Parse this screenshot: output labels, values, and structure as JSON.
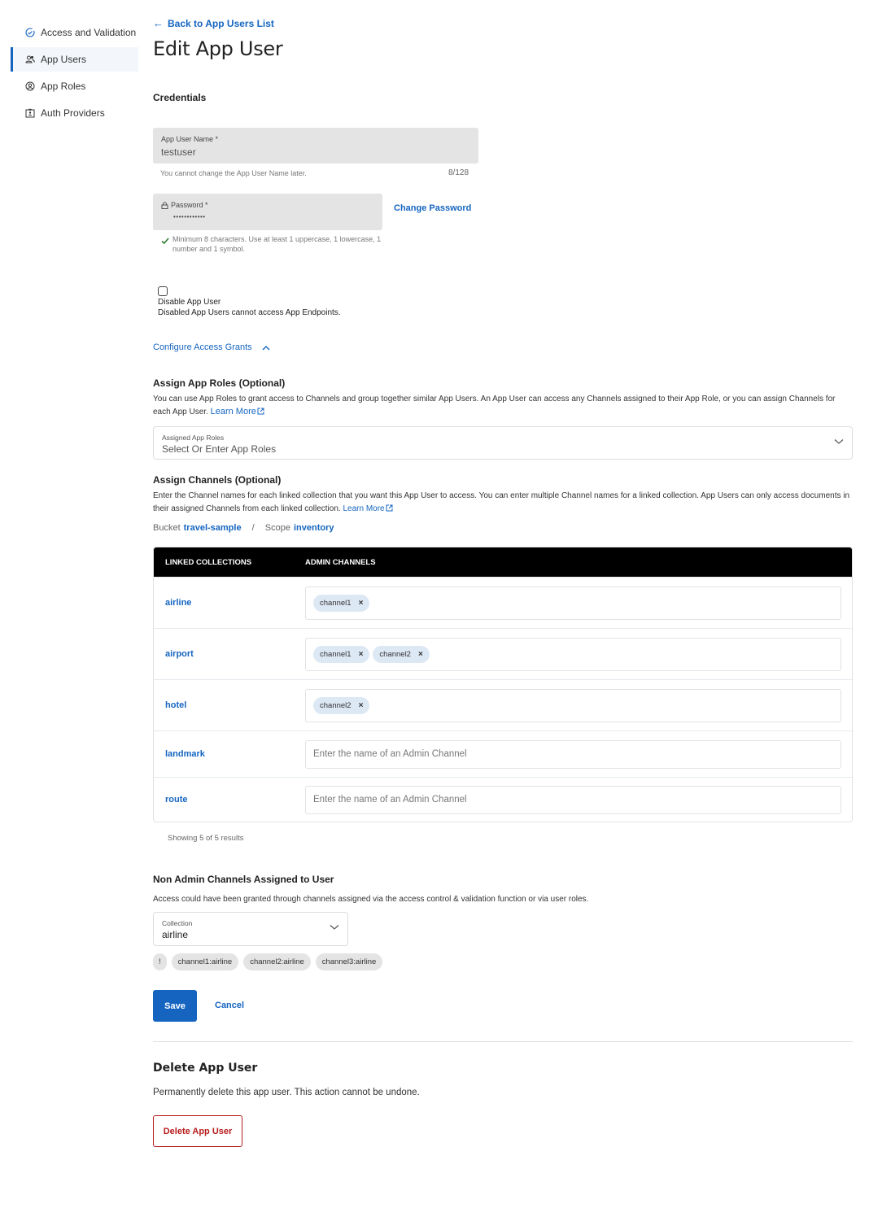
{
  "sidebar": {
    "items": [
      {
        "label": "Access and Validation",
        "icon": "check-circle-icon",
        "active": false
      },
      {
        "label": "App Users",
        "icon": "users-icon",
        "active": true
      },
      {
        "label": "App Roles",
        "icon": "role-icon",
        "active": false
      },
      {
        "label": "Auth Providers",
        "icon": "id-badge-icon",
        "active": false
      }
    ]
  },
  "header": {
    "back_link": "Back to App Users List",
    "title": "Edit App User"
  },
  "credentials": {
    "section_label": "Credentials",
    "username": {
      "label": "App User Name *",
      "value": "testuser",
      "helper": "You cannot change the App User Name later.",
      "counter": "8/128"
    },
    "password": {
      "label": "Password *",
      "value": "••••••••••••",
      "helper": "Minimum 8 characters. Use at least 1 uppercase, 1 lowercase, 1 number and 1 symbol.",
      "change_link": "Change Password"
    },
    "disable": {
      "checked": false,
      "label": "Disable App User",
      "description": "Disabled App Users cannot access App Endpoints."
    }
  },
  "access_grants": {
    "toggle_label": "Configure Access Grants",
    "roles": {
      "title": "Assign App Roles (Optional)",
      "description": "You can use App Roles to grant access to Channels and group together similar App Users. An App User can access any Channels assigned to their App Role, or you can assign Channels for each App User.",
      "learn_more": "Learn More",
      "select_label": "Assigned App Roles",
      "select_placeholder": "Select Or Enter App Roles"
    },
    "channels": {
      "title": "Assign Channels (Optional)",
      "description": "Enter the Channel names for each linked collection that you want this App User to access. You can enter multiple Channel names for a linked collection. App Users can only access documents in their assigned Channels from each linked collection.",
      "learn_more": "Learn More",
      "bucket_label": "Bucket",
      "bucket_value": "travel-sample",
      "separator": "/",
      "scope_label": "Scope",
      "scope_value": "inventory",
      "table": {
        "headers": [
          "LINKED COLLECTIONS",
          "ADMIN CHANNELS"
        ],
        "placeholder": "Enter the name of an Admin Channel",
        "rows": [
          {
            "collection": "airline",
            "channels": [
              "channel1"
            ]
          },
          {
            "collection": "airport",
            "channels": [
              "channel1",
              "channel2"
            ]
          },
          {
            "collection": "hotel",
            "channels": [
              "channel2"
            ]
          },
          {
            "collection": "landmark",
            "channels": []
          },
          {
            "collection": "route",
            "channels": []
          }
        ]
      },
      "showing": "Showing 5 of 5 results"
    }
  },
  "non_admin": {
    "title": "Non Admin Channels Assigned to User",
    "description": "Access could have been granted through channels assigned via the access control & validation function or via user roles.",
    "collection_label": "Collection",
    "collection_value": "airline",
    "info_chip": "!",
    "chips": [
      "channel1:airline",
      "channel2:airline",
      "channel3:airline"
    ]
  },
  "actions": {
    "save": "Save",
    "cancel": "Cancel"
  },
  "delete": {
    "title": "Delete App User",
    "description": "Permanently delete this app user. This action cannot be undone.",
    "button": "Delete App User"
  },
  "colors": {
    "accent": "#1565c0",
    "danger": "#b71c1c",
    "success": "#2e7d32"
  }
}
